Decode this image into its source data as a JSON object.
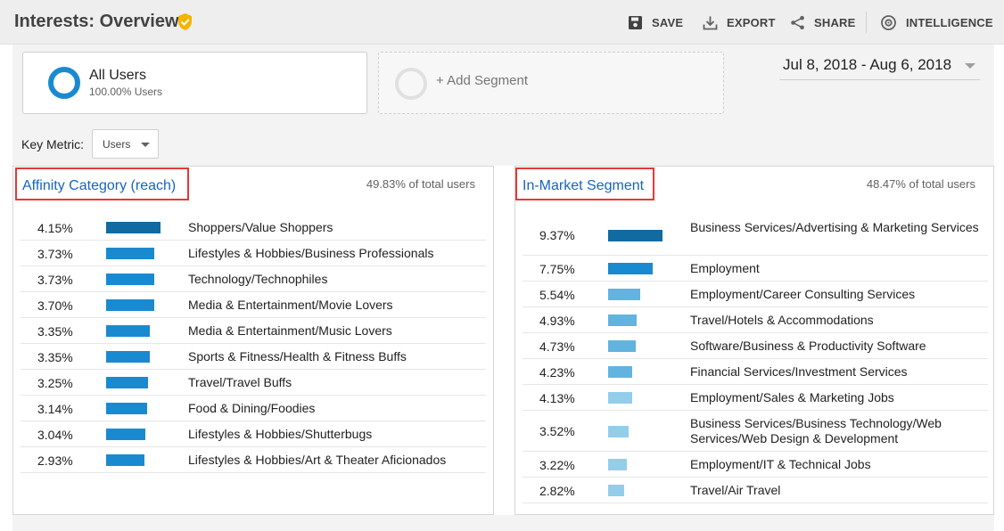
{
  "header": {
    "title": "Interests: Overview",
    "toolbar": {
      "save": "SAVE",
      "export": "EXPORT",
      "share": "SHARE",
      "intelligence": "INTELLIGENCE"
    }
  },
  "segments": {
    "active": {
      "name": "All Users",
      "percent": "100.00% Users"
    },
    "add_label": "+ Add Segment"
  },
  "date_range": "Jul 8, 2018 - Aug 6, 2018",
  "key_metric": {
    "label": "Key Metric:",
    "value": "Users"
  },
  "colors": {
    "bar_dark": "#116aa1",
    "bar_mid": "#1a8ad0",
    "bar_light": "#62b3e0",
    "bar_lightest": "#94cdea",
    "highlight": "#e53935",
    "link": "#1565c0"
  },
  "affinity": {
    "title": "Affinity Category (reach)",
    "total": "49.83% of total users",
    "rows": [
      {
        "pct": "4.15%",
        "value": 4.15,
        "label": "Shoppers/Value Shoppers"
      },
      {
        "pct": "3.73%",
        "value": 3.73,
        "label": "Lifestyles & Hobbies/Business Professionals"
      },
      {
        "pct": "3.73%",
        "value": 3.73,
        "label": "Technology/Technophiles"
      },
      {
        "pct": "3.70%",
        "value": 3.7,
        "label": "Media & Entertainment/Movie Lovers"
      },
      {
        "pct": "3.35%",
        "value": 3.35,
        "label": "Media & Entertainment/Music Lovers"
      },
      {
        "pct": "3.35%",
        "value": 3.35,
        "label": "Sports & Fitness/Health & Fitness Buffs"
      },
      {
        "pct": "3.25%",
        "value": 3.25,
        "label": "Travel/Travel Buffs"
      },
      {
        "pct": "3.14%",
        "value": 3.14,
        "label": "Food & Dining/Foodies"
      },
      {
        "pct": "3.04%",
        "value": 3.04,
        "label": "Lifestyles & Hobbies/Shutterbugs"
      },
      {
        "pct": "2.93%",
        "value": 2.93,
        "label": "Lifestyles & Hobbies/Art & Theater Aficionados"
      }
    ]
  },
  "in_market": {
    "title": "In-Market Segment",
    "total": "48.47% of total users",
    "rows": [
      {
        "pct": "9.37%",
        "value": 9.37,
        "label": "Business Services/Advertising & Marketing Services"
      },
      {
        "pct": "7.75%",
        "value": 7.75,
        "label": "Employment"
      },
      {
        "pct": "5.54%",
        "value": 5.54,
        "label": "Employment/Career Consulting Services"
      },
      {
        "pct": "4.93%",
        "value": 4.93,
        "label": "Travel/Hotels & Accommodations"
      },
      {
        "pct": "4.73%",
        "value": 4.73,
        "label": "Software/Business & Productivity Software"
      },
      {
        "pct": "4.23%",
        "value": 4.23,
        "label": "Financial Services/Investment Services"
      },
      {
        "pct": "4.13%",
        "value": 4.13,
        "label": "Employment/Sales & Marketing Jobs"
      },
      {
        "pct": "3.52%",
        "value": 3.52,
        "label": "Business Services/Business Technology/Web Services/Web Design & Development"
      },
      {
        "pct": "3.22%",
        "value": 3.22,
        "label": "Employment/IT & Technical Jobs"
      },
      {
        "pct": "2.82%",
        "value": 2.82,
        "label": "Travel/Air Travel"
      }
    ]
  }
}
